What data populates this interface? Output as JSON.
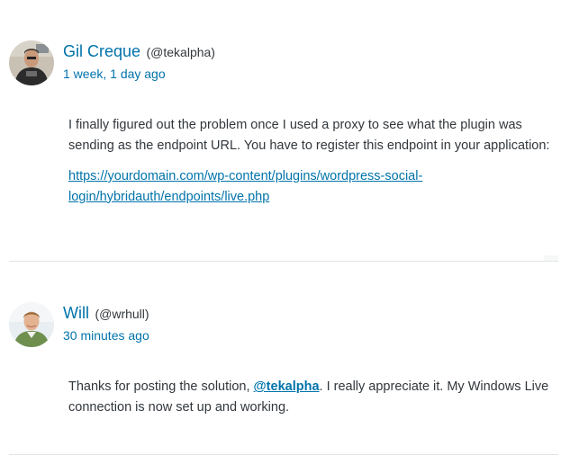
{
  "replies": [
    {
      "author_name": "Gil Creque",
      "author_handle": "(@tekalpha)",
      "time": "1 week, 1 day ago",
      "text_1": "I finally figured out the problem once I used a proxy to see what the plugin was sending as the endpoint URL. You have to register this endpoint in your application:",
      "link": "https://yourdomain.com/wp-content/plugins/wordpress-social-login/hybridauth/endpoints/live.php",
      "avatar_icon": "user-avatar-photo"
    },
    {
      "author_name": "Will",
      "author_handle": "(@wrhull)",
      "time": "30 minutes ago",
      "text_before": "Thanks for posting the solution, ",
      "mention": "@tekalpha",
      "text_after": ". I really appreciate it. My Windows Live connection is now set up and working.",
      "avatar_icon": "user-avatar-photo"
    }
  ],
  "colors": {
    "link": "#0073aa",
    "text": "#32373c",
    "separator": "#e2e4e7"
  }
}
